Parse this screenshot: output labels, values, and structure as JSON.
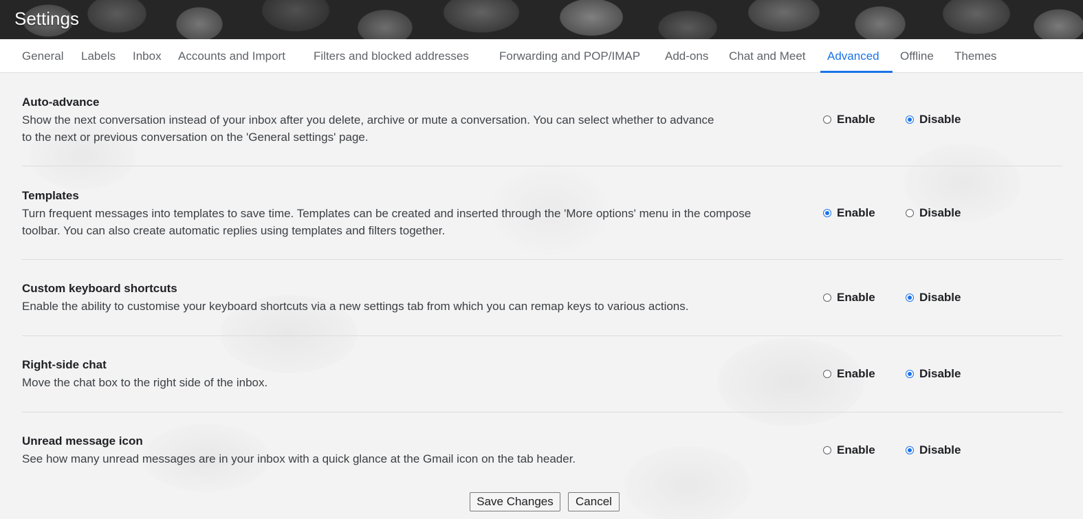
{
  "header": {
    "title": "Settings"
  },
  "tabs": [
    {
      "label": "General"
    },
    {
      "label": "Labels"
    },
    {
      "label": "Inbox"
    },
    {
      "label": "Accounts and Import"
    },
    {
      "label": "Filters and blocked addresses"
    },
    {
      "label": "Forwarding and POP/IMAP"
    },
    {
      "label": "Add-ons"
    },
    {
      "label": "Chat and Meet"
    },
    {
      "label": "Advanced",
      "active": true
    },
    {
      "label": "Offline"
    },
    {
      "label": "Themes"
    }
  ],
  "settings": [
    {
      "title": "Auto-advance",
      "description": "Show the next conversation instead of your inbox after you delete, archive or mute a conversation. You can select whether to advance to the next or previous conversation on the 'General settings' page.",
      "enable_label": "Enable",
      "disable_label": "Disable",
      "selected": "Disable"
    },
    {
      "title": "Templates",
      "description": "Turn frequent messages into templates to save time. Templates can be created and inserted through the 'More options' menu in the compose toolbar. You can also create automatic replies using templates and filters together.",
      "enable_label": "Enable",
      "disable_label": "Disable",
      "selected": "Enable"
    },
    {
      "title": "Custom keyboard shortcuts",
      "description": "Enable the ability to customise your keyboard shortcuts via a new settings tab from which you can remap keys to various actions.",
      "enable_label": "Enable",
      "disable_label": "Disable",
      "selected": "Disable"
    },
    {
      "title": "Right-side chat",
      "description": "Move the chat box to the right side of the inbox.",
      "enable_label": "Enable",
      "disable_label": "Disable",
      "selected": "Disable"
    },
    {
      "title": "Unread message icon",
      "description": "See how many unread messages are in your inbox with a quick glance at the Gmail icon on the tab header.",
      "enable_label": "Enable",
      "disable_label": "Disable",
      "selected": "Disable"
    }
  ],
  "buttons": {
    "save_label": "Save Changes",
    "cancel_label": "Cancel"
  },
  "colors": {
    "accent": "#1a73e8",
    "tab_text": "#5f6368"
  }
}
